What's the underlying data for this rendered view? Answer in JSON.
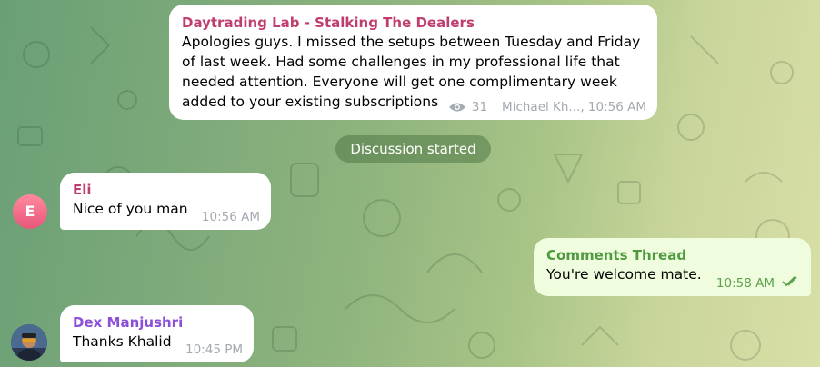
{
  "channel_post": {
    "sender": "Daytrading Lab - Stalking The Dealers",
    "text": "Apologies guys. I missed the setups between Tuesday and Friday of last week. Had some challenges in my professional life that needed attention.  Everyone will get one complimentary week added to your existing subscriptions",
    "views": "31",
    "author_time": "Michael Kh..., 10:56 AM",
    "view_icon": "eye-icon"
  },
  "service_message": "Discussion started",
  "messages": [
    {
      "sender": "Eli",
      "avatar_letter": "E",
      "text": "Nice of you man",
      "time": "10:56 AM"
    },
    {
      "sender": "Comments Thread",
      "text": "You're welcome mate.",
      "time": "10:58 AM",
      "status_icon": "double-check-icon"
    },
    {
      "sender": "Dex Manjushri",
      "text": "Thanks Khalid",
      "time": "10:45 PM"
    }
  ],
  "colors": {
    "channel_name": "#c03d70",
    "eli_name": "#c03d70",
    "outgoing_name": "#4f9a40",
    "dex_name": "#8b4fd8",
    "outgoing_bg": "#effdde"
  }
}
